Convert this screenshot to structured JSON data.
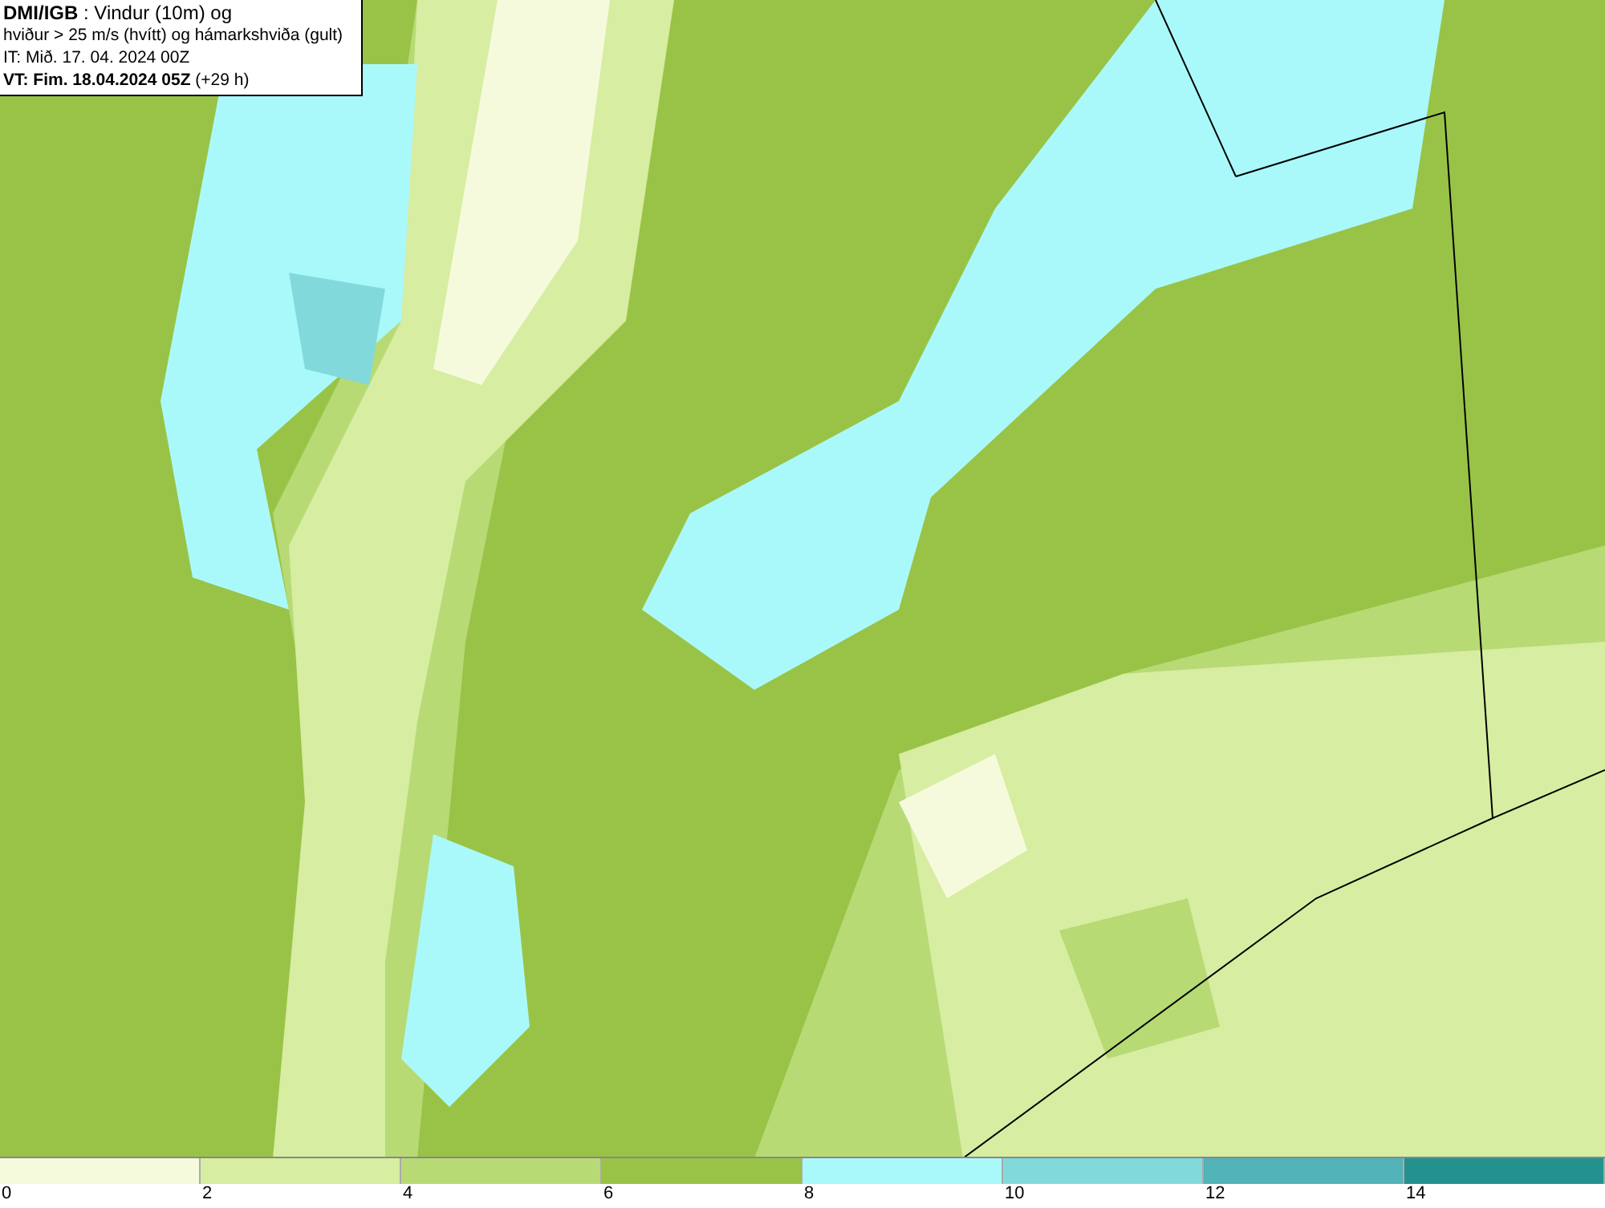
{
  "map": {
    "info_lines": [
      "**DMI/IGB** : Vindur (10m) og",
      "hviður > 25 m/s (hvítt) og hámarkshviða (gult)",
      "IT: Mið. 17. 04. 2024 00Z",
      "**VT: Fim. 18.04.2024 05Z** (+29 h)"
    ]
  },
  "legend": [
    {
      "label": "0",
      "color": "#f6fadc"
    },
    {
      "label": "2",
      "color": "#d7eda1"
    },
    {
      "label": "4",
      "color": "#b7da75"
    },
    {
      "label": "6",
      "color": "#99c347"
    },
    {
      "label": "8",
      "color": "#aaf9fa"
    },
    {
      "label": "10",
      "color": "#82d9dc"
    },
    {
      "label": "12",
      "color": "#52b3b8"
    },
    {
      "label": "14",
      "color": "#23928f"
    }
  ]
}
